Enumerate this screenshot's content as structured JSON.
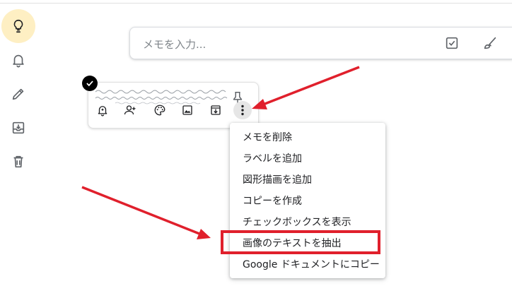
{
  "sidebar": {
    "items": [
      {
        "icon": "lightbulb-icon",
        "active": true
      },
      {
        "icon": "bell-icon",
        "active": false
      },
      {
        "icon": "pencil-icon",
        "active": false
      },
      {
        "icon": "archive-icon",
        "active": false
      },
      {
        "icon": "trash-icon",
        "active": false
      }
    ]
  },
  "note_input": {
    "placeholder": "メモを入力..."
  },
  "context_menu": {
    "items": [
      {
        "label": "メモを削除"
      },
      {
        "label": "ラベルを追加"
      },
      {
        "label": "図形描画を追加"
      },
      {
        "label": "コピーを作成"
      },
      {
        "label": "チェックボックスを表示"
      },
      {
        "label": "画像のテキストを抽出",
        "highlighted": true
      },
      {
        "label": "Google ドキュメントにコピー"
      }
    ]
  },
  "colors": {
    "active_sidebar": "#feefc3",
    "annotation_red": "#e0202c",
    "icon_gray": "#5f6368"
  }
}
